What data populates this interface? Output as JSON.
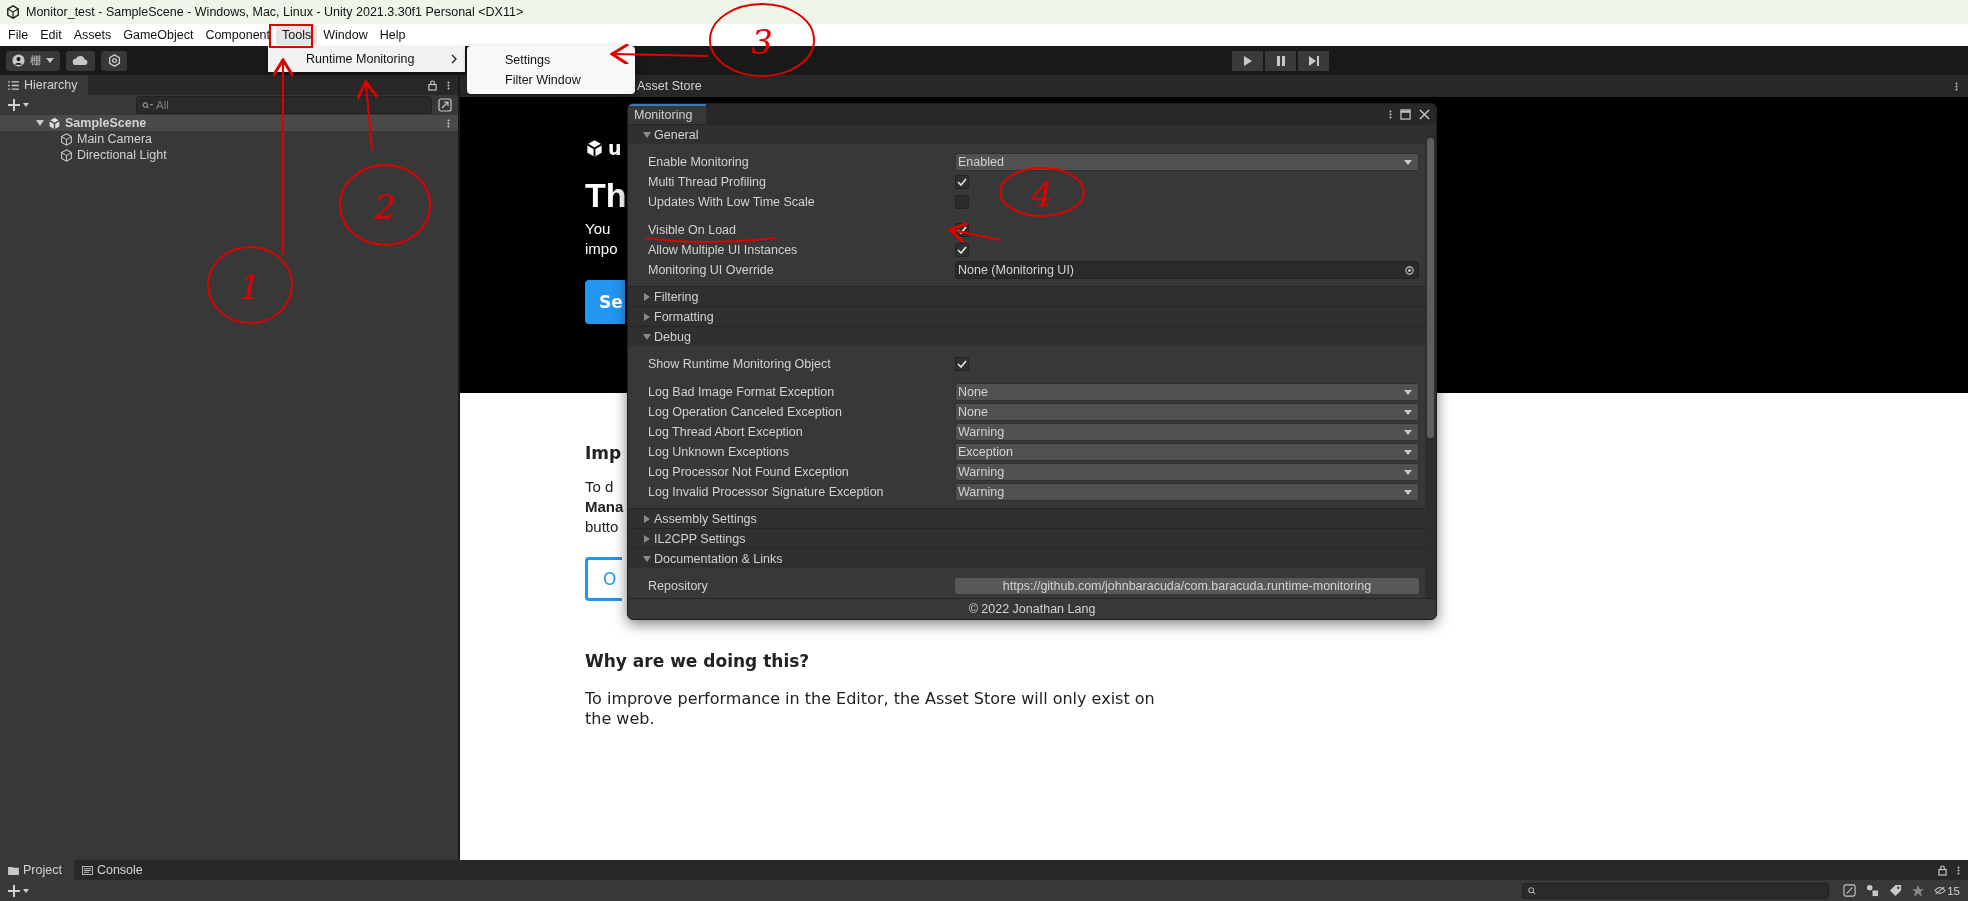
{
  "window": {
    "title": "Monitor_test - SampleScene - Windows, Mac, Linux - Unity 2021.3.30f1 Personal <DX11>"
  },
  "menu_bar": [
    {
      "label": "File",
      "selected": false
    },
    {
      "label": "Edit",
      "selected": false
    },
    {
      "label": "Assets",
      "selected": false
    },
    {
      "label": "GameObject",
      "selected": false
    },
    {
      "label": "Component",
      "selected": false
    },
    {
      "label": "Tools",
      "selected": true
    },
    {
      "label": "Window",
      "selected": false
    },
    {
      "label": "Help",
      "selected": false
    }
  ],
  "tools_menu": [
    {
      "label": "Runtime Monitoring",
      "submenu": [
        {
          "label": "Settings"
        },
        {
          "label": "Filter Window"
        }
      ]
    }
  ],
  "toolbar": {
    "account": "棚"
  },
  "hierarchy": {
    "title": "Hierarchy",
    "search_placeholder": "All",
    "tree": [
      {
        "label": "SampleScene",
        "kind": "scene",
        "expanded": true,
        "children": [
          {
            "label": "Main Camera",
            "kind": "object"
          },
          {
            "label": "Directional Light",
            "kind": "object"
          }
        ]
      }
    ]
  },
  "asset_store": {
    "tab": "Asset Store",
    "hero": {
      "logo_text": "u",
      "heading": "Th",
      "lines": [
        "You",
        "impo"
      ],
      "button": "Se"
    },
    "section": {
      "heading": "Imp",
      "lines": [
        {
          "text": "To d",
          "bold": false
        },
        {
          "text": "Mana",
          "bold": true
        },
        {
          "text": "butto",
          "bold": false
        }
      ],
      "button": "O"
    },
    "why": {
      "heading": "Why are we doing this?",
      "text": "To improve performance in the Editor, the Asset Store will only exist on the web."
    }
  },
  "monitoring": {
    "tab": "Monitoring",
    "sections": [
      {
        "title": "General",
        "expanded": true,
        "fields": [
          {
            "label": "Enable Monitoring",
            "kind": "dropdown",
            "value": "Enabled",
            "spaced": false
          },
          {
            "label": "Multi Thread Profiling",
            "kind": "checkbox",
            "checked": true,
            "spaced": false
          },
          {
            "label": "Updates With Low Time Scale",
            "kind": "checkbox",
            "checked": false,
            "spaced": false
          },
          {
            "label": "Visible On Load",
            "kind": "checkbox",
            "checked": true,
            "spaced": true
          },
          {
            "label": "Allow Multiple UI Instances",
            "kind": "checkbox",
            "checked": true,
            "spaced": false
          },
          {
            "label": "Monitoring UI Override",
            "kind": "object",
            "value": "None (Monitoring UI)",
            "spaced": false
          }
        ]
      },
      {
        "title": "Filtering",
        "expanded": false
      },
      {
        "title": "Formatting",
        "expanded": false
      },
      {
        "title": "Debug",
        "expanded": true,
        "fields": [
          {
            "label": "Show Runtime Monitoring Object",
            "kind": "checkbox",
            "checked": true,
            "spaced": false
          },
          {
            "label": "Log Bad Image Format Exception",
            "kind": "dropdown",
            "value": "None",
            "spaced": true
          },
          {
            "label": "Log Operation Canceled Exception",
            "kind": "dropdown",
            "value": "None",
            "spaced": false
          },
          {
            "label": "Log Thread Abort Exception",
            "kind": "dropdown",
            "value": "Warning",
            "spaced": false
          },
          {
            "label": "Log Unknown Exceptions",
            "kind": "dropdown",
            "value": "Exception",
            "spaced": false
          },
          {
            "label": "Log Processor Not Found Exception",
            "kind": "dropdown",
            "value": "Warning",
            "spaced": false
          },
          {
            "label": "Log Invalid Processor Signature Exception",
            "kind": "dropdown",
            "value": "Warning",
            "spaced": false
          }
        ]
      },
      {
        "title": "Assembly Settings",
        "expanded": false
      },
      {
        "title": "IL2CPP Settings",
        "expanded": false
      },
      {
        "title": "Documentation & Links",
        "expanded": true,
        "fields": [
          {
            "label": "Repository",
            "kind": "link",
            "value": "https://github.com/johnbaracuda/com.baracuda.runtime-monitoring",
            "spaced": false
          }
        ]
      }
    ],
    "footer": "© 2022 Jonathan Lang"
  },
  "bottom": {
    "tabs": [
      {
        "label": "Project",
        "selected": true
      },
      {
        "label": "Console",
        "selected": false
      }
    ],
    "hidden_count": "15"
  },
  "annotations": [
    {
      "label": "1"
    },
    {
      "label": "2"
    },
    {
      "label": "3"
    },
    {
      "label": "4"
    }
  ]
}
